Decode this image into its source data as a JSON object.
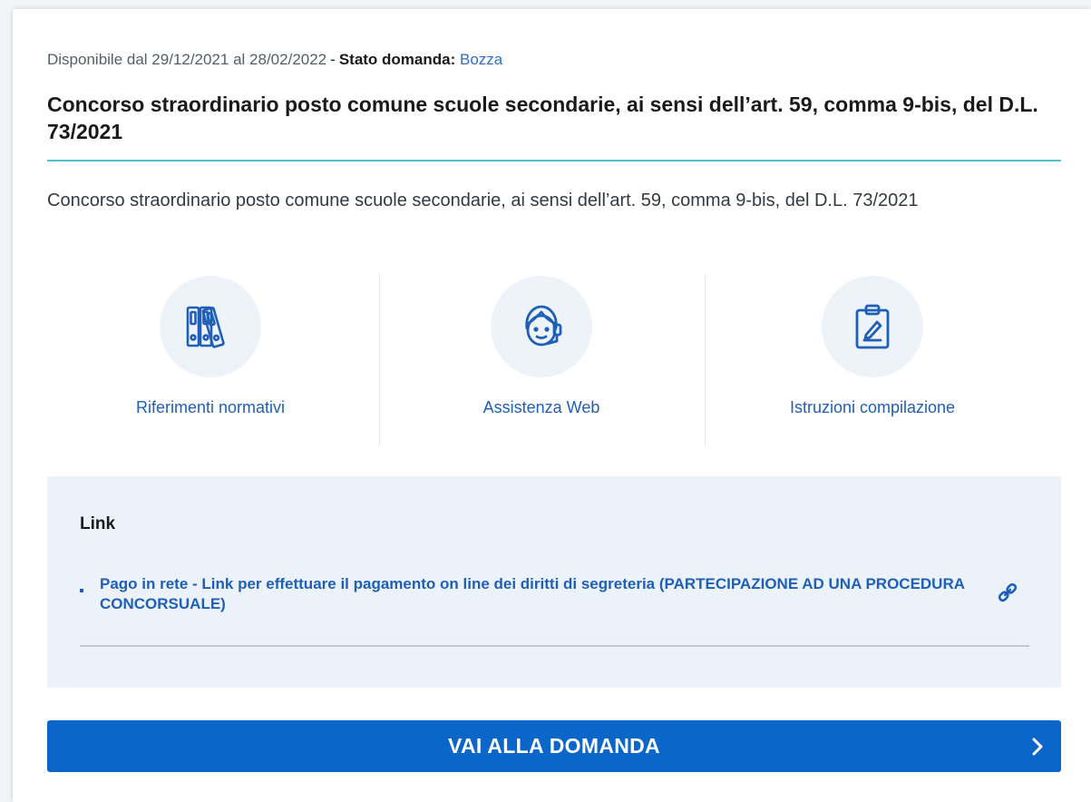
{
  "meta": {
    "availability": "Disponibile dal 29/12/2021 al 28/02/2022",
    "separator": "-",
    "status_label": "Stato domanda:",
    "status_value": "Bozza"
  },
  "title": "Concorso straordinario posto comune scuole secondarie, ai sensi dell’art. 59, comma 9-bis, del D.L. 73/2021",
  "description": "Concorso straordinario posto comune scuole secondarie, ai sensi dell’art. 59, comma 9-bis, del D.L. 73/2021",
  "features": [
    {
      "label": "Riferimenti normativi",
      "icon": "binders-icon"
    },
    {
      "label": "Assistenza Web",
      "icon": "headset-support-icon"
    },
    {
      "label": "Istruzioni compilazione",
      "icon": "clipboard-edit-icon"
    }
  ],
  "links": {
    "heading": "Link",
    "items": [
      {
        "text": "Pago in rete - Link per effettuare il pagamento on line dei diritti di segreteria (PARTECIPAZIONE AD UNA PROCEDURA CONCORSUALE)",
        "icon": "link-icon"
      }
    ]
  },
  "cta": {
    "label": "VAI ALLA DOMANDA",
    "icon": "chevron-right-icon"
  },
  "colors": {
    "accent_blue": "#0a66c8",
    "link_blue": "#1f5fb8",
    "title_rule": "#4fc3cf",
    "panel_bg": "#ebf2fa"
  }
}
